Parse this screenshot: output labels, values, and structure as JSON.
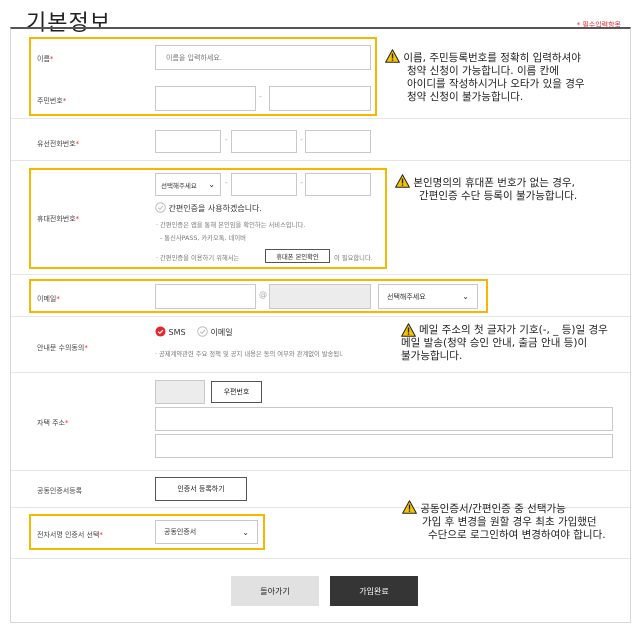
{
  "page_title": "기본정보",
  "required_note": "* 필수입력항목",
  "name": {
    "label": "이름",
    "required_mark": "*",
    "placeholder": "이름을 입력하세요.",
    "annotation": [
      "이름, 주민등록번호를 정확히 입력하셔야",
      "청약 신청이 가능합니다. 이름 칸에",
      "아이디를 작성하시거나 오타가 있을 경우",
      "청약 신청이 불가능합니다."
    ]
  },
  "rrn": {
    "label": "주민번호",
    "required_mark": "*",
    "separator": "-"
  },
  "landline": {
    "label": "유선전화번호",
    "required_mark": "*",
    "separator": "-"
  },
  "mobile": {
    "label": "휴대전화번호",
    "required_mark": "*",
    "carrier_select": "선택해주세요",
    "separator": "-",
    "simple_auth_label": "간편인증을 사용하겠습니다.",
    "info_1": "· 간편인증은 앱을 통해 본인임을 확인하는 서비스입니다.",
    "info_2": "- 통신사PASS, 카카오톡, 네이버",
    "info_3_pre": "· 간편인증을 이용하기 위해서는",
    "verify_button": "휴대폰 본인확인",
    "info_3_post": "이 필요합니다.",
    "annotation": [
      "본인명의의 휴대폰 번호가 없는 경우,",
      "간편인증 수단 등록이 불가능합니다."
    ]
  },
  "email": {
    "label": "이메일",
    "required_mark": "*",
    "at_sign": "@",
    "domain_select": "선택해주세요",
    "annotation": [
      "메일 주소의 첫 글자가 기호(-, _ 등)일 경우",
      "메일 발송(청약 승인 안내, 출금 안내 등)이",
      "불가능합니다."
    ]
  },
  "consent": {
    "label": "안내문 수의동의",
    "required_mark": "*",
    "option_sms": "SMS",
    "option_email": "이메일",
    "info": "· 공제계약관련 주요 정책 및 공지 내용은 동의 여부와 관계없이 발송됩니다."
  },
  "address": {
    "label": "자택 주소",
    "required_mark": "*",
    "postcode_button": "우편번호"
  },
  "certificate": {
    "label": "공동인증서등록",
    "register_button": "인증서 등록하기"
  },
  "signature": {
    "label": "전자서명 인증서 선택",
    "required_mark": "*",
    "select_value": "공동인증서",
    "annotation": [
      "공동인증서/간편인증 중 선택가능",
      "가입 후 변경을 원할 경우 최초 가입했던",
      "수단으로 로그인하여 변경하여야 합니다."
    ]
  },
  "buttons": {
    "back": "돌아가기",
    "submit": "가입완료"
  },
  "colors": {
    "highlight": "#f5b800",
    "required": "#e4262d",
    "primary_button": "#353535"
  },
  "icons": [
    "warning-icon",
    "chevron-down-icon",
    "check-circle-icon"
  ]
}
